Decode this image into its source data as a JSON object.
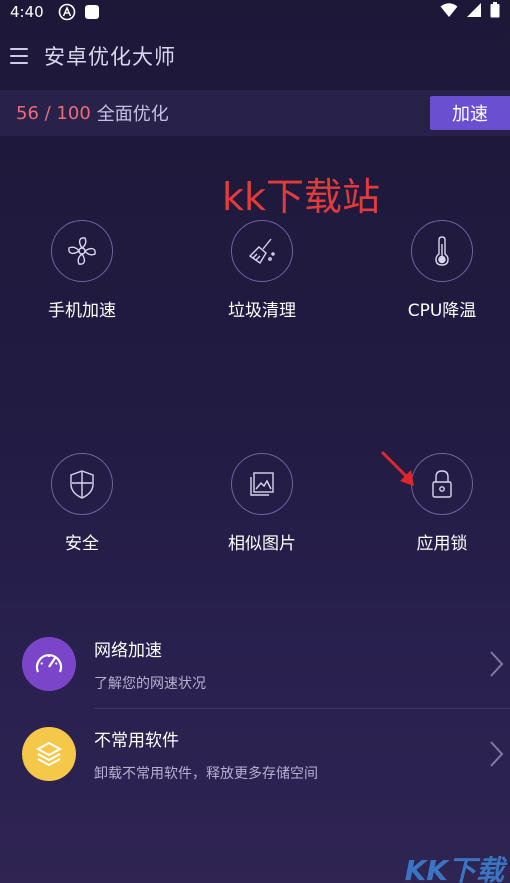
{
  "status": {
    "time": "4:40"
  },
  "appbar": {
    "title": "安卓优化大师"
  },
  "score": {
    "value": "56 / 100",
    "label": "全面优化",
    "boost_label": "加速"
  },
  "watermark": "kk下载站",
  "grid": [
    {
      "label": "手机加速",
      "icon": "fan-icon"
    },
    {
      "label": "垃圾清理",
      "icon": "broom-icon"
    },
    {
      "label": "CPU降温",
      "icon": "thermometer-icon"
    },
    {
      "label": "安全",
      "icon": "shield-icon"
    },
    {
      "label": "相似图片",
      "icon": "photos-icon"
    },
    {
      "label": "应用锁",
      "icon": "lock-icon"
    }
  ],
  "list": [
    {
      "title": "网络加速",
      "desc": "了解您的网速状况",
      "icon": "speedometer-icon",
      "color": "#7a45c8"
    },
    {
      "title": "不常用软件",
      "desc": "卸载不常用软件，释放更多存储空间",
      "icon": "box-icon",
      "color": "#f6c84a"
    }
  ],
  "corner_logo": "KK下载"
}
